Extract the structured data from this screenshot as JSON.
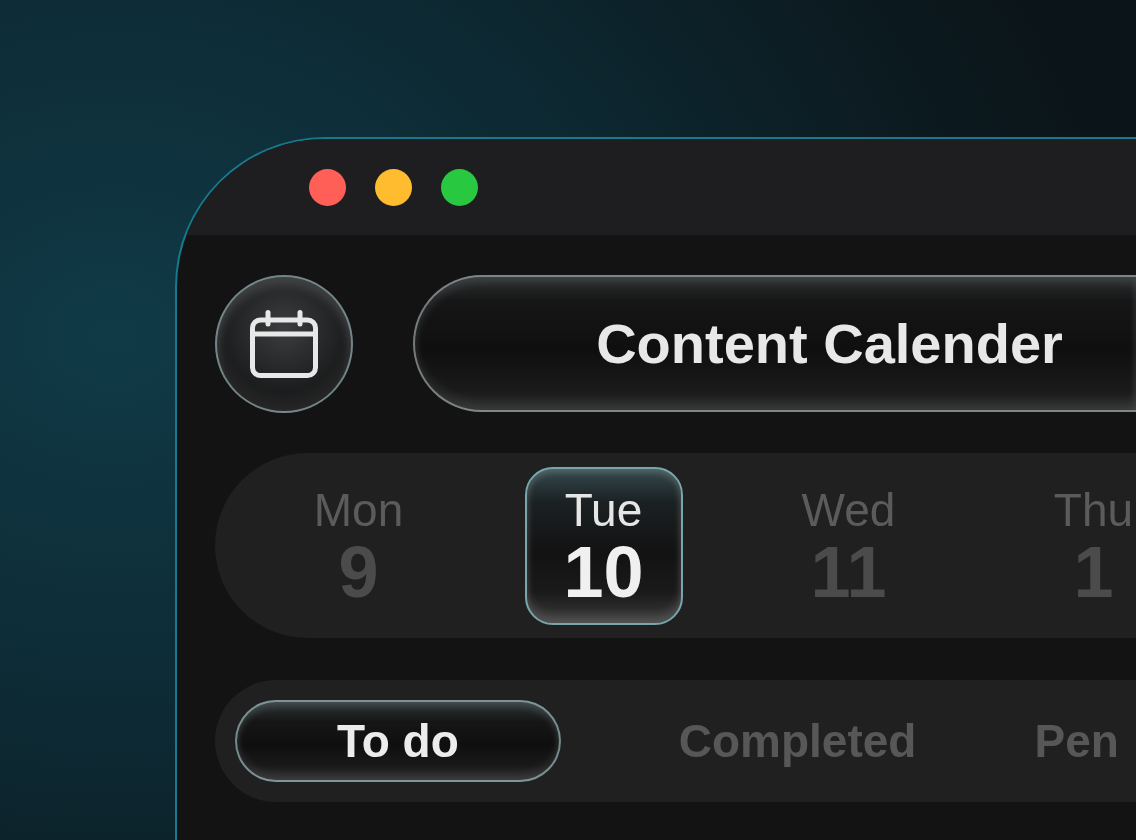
{
  "window": {
    "controls": [
      {
        "color": "#ff5f57"
      },
      {
        "color": "#febc2e"
      },
      {
        "color": "#28c840"
      }
    ]
  },
  "header": {
    "title": "Content Calender"
  },
  "days": [
    {
      "name": "Mon",
      "date": "9",
      "selected": false
    },
    {
      "name": "Tue",
      "date": "10",
      "selected": true
    },
    {
      "name": "Wed",
      "date": "11",
      "selected": false
    },
    {
      "name": "Thu",
      "date": "1",
      "selected": false
    }
  ],
  "tabs": [
    {
      "label": "To do",
      "selected": true
    },
    {
      "label": "Completed",
      "selected": false
    },
    {
      "label": "Pen",
      "selected": false
    }
  ]
}
